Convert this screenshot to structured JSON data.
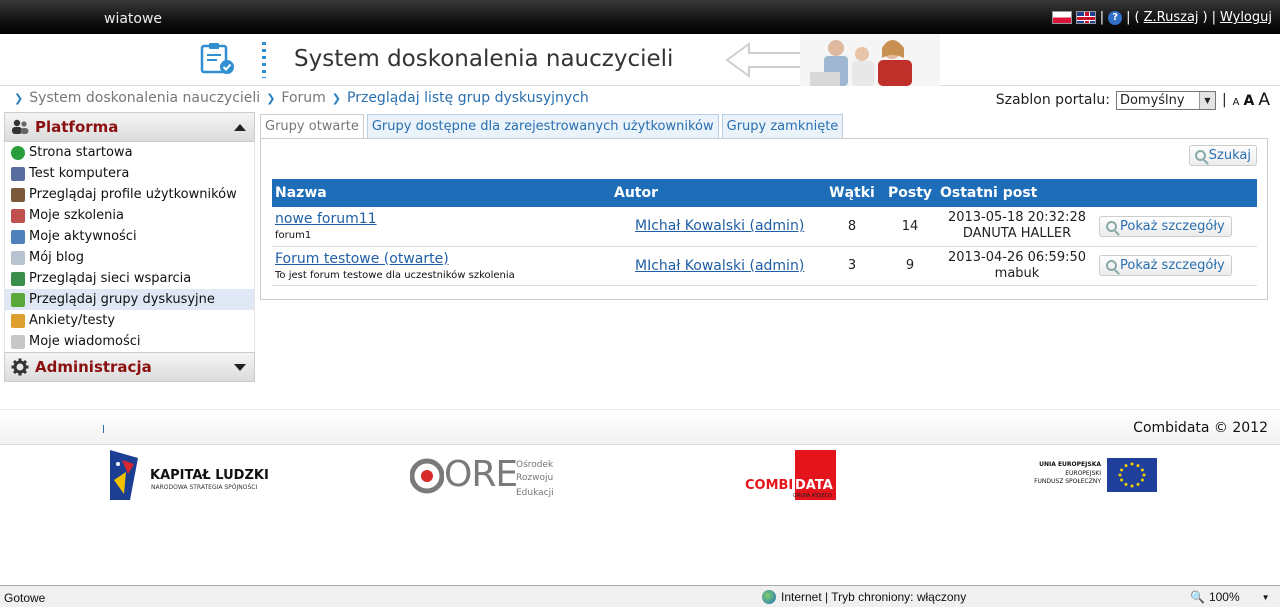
{
  "topbar": {
    "site_fragment": "wiatowe",
    "user_link": "Z.Ruszaj",
    "logout": "Wyloguj",
    "open_paren": "( ",
    "close_paren": " )",
    "bar": "|"
  },
  "header": {
    "title": "System doskonalenia nauczycieli"
  },
  "breadcrumb": {
    "items": [
      "System doskonalenia nauczycieli",
      "Forum",
      "Przeglądaj listę grup dyskusyjnych"
    ]
  },
  "template": {
    "label": "Szablon portalu:",
    "selected": "Domyślny",
    "font_small": "A",
    "font_medium": "A",
    "font_large": "A"
  },
  "sidebar": {
    "section1": "Platforma",
    "items": [
      {
        "label": "Strona startowa",
        "icon": "home-arrow-icon",
        "color": "#2a9d3c"
      },
      {
        "label": "Test komputera",
        "icon": "computer-icon",
        "color": "#5a6fa0"
      },
      {
        "label": "Przeglądaj profile użytkowników",
        "icon": "users-icon",
        "color": "#7a5a3a"
      },
      {
        "label": "Moje szkolenia",
        "icon": "books-icon",
        "color": "#c0504d"
      },
      {
        "label": "Moje aktywności",
        "icon": "activity-icon",
        "color": "#4f81bd"
      },
      {
        "label": "Mój blog",
        "icon": "blog-icon",
        "color": "#b8c4d0"
      },
      {
        "label": "Przeglądaj sieci wsparcia",
        "icon": "network-icon",
        "color": "#3a8f4a"
      },
      {
        "label": "Przeglądaj grupy dyskusyjne",
        "icon": "discussion-icon",
        "color": "#5aa83a"
      },
      {
        "label": "Ankiety/testy",
        "icon": "survey-icon",
        "color": "#e0a030"
      },
      {
        "label": "Moje wiadomości",
        "icon": "mail-icon",
        "color": "#c8c8c8"
      }
    ],
    "selected_index": 7,
    "section2": "Administracja"
  },
  "tabs": [
    "Grupy otwarte",
    "Grupy dostępne dla zarejestrowanych użytkowników",
    "Grupy zamknięte"
  ],
  "search_label": "Szukaj",
  "table": {
    "headers": [
      "Nazwa",
      "Autor",
      "Wątki",
      "Posty",
      "Ostatni post"
    ],
    "rows": [
      {
        "name": "nowe forum11",
        "desc": "forum1",
        "author": "MIchał Kowalski (admin)",
        "threads": "8",
        "posts": "14",
        "last_date": "2013-05-18 20:32:28",
        "last_user": "DANUTA HALLER",
        "action": "Pokaż szczegóły"
      },
      {
        "name": "Forum testowe (otwarte)",
        "desc": "To jest forum testowe dla uczestników szkolenia",
        "author": "MIchał Kowalski (admin)",
        "threads": "3",
        "posts": "9",
        "last_date": "2013-04-26 06:59:50",
        "last_user": "mabuk",
        "action": "Pokaż szczegóły"
      }
    ]
  },
  "footer": {
    "copyright": "Combidata © 2012",
    "logo1_title": "KAPITAŁ LUDZKI",
    "logo1_sub": "NARODOWA STRATEGIA SPÓJNOŚCI",
    "logo2_letters": "ORE",
    "logo2_line1": "Ośrodek",
    "logo2_line2": "Rozwoju",
    "logo2_line3": "Edukacji",
    "logo3_left": "COMBI",
    "logo3_right": "DATA",
    "logo3_sub": "GRUPA ASSECO",
    "logo4_line1": "UNIA EUROPEJSKA",
    "logo4_line2": "EUROPEJSKI",
    "logo4_line3": "FUNDUSZ SPOŁECZNY"
  },
  "statusbar": {
    "left": "Gotowe",
    "zone": "Internet | Tryb chroniony: włączony",
    "zoom": "100%"
  }
}
